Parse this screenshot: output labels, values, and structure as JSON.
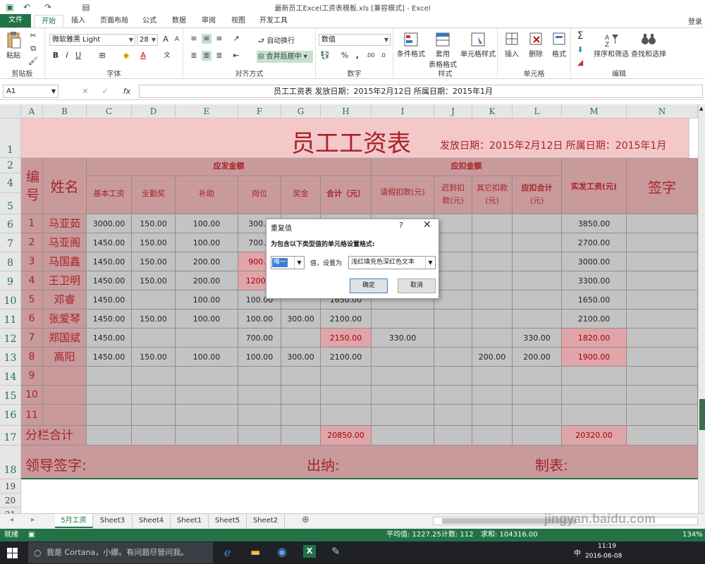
{
  "window": {
    "title": "最新员工Excel工资表模板.xls  [兼容模式] - Excel"
  },
  "tabs": [
    "文件",
    "开始",
    "插入",
    "页面布局",
    "公式",
    "数据",
    "审阅",
    "视图",
    "开发工具"
  ],
  "login": "登录",
  "ribbon": {
    "clipboard": {
      "paste": "粘贴",
      "label": "剪贴板"
    },
    "font": {
      "name": "微软雅黑 Light",
      "size": "28",
      "label": "字体"
    },
    "align": {
      "wrap": "自动换行",
      "merge": "合并后居中",
      "label": "对齐方式"
    },
    "number": {
      "format": "数值",
      "label": "数字"
    },
    "styles": {
      "cond": "条件格式",
      "table1": "套用",
      "table2": "表格格式",
      "cell": "单元格样式",
      "label": "样式"
    },
    "cells": {
      "insert": "插入",
      "delete": "删除",
      "format": "格式",
      "label": "单元格"
    },
    "edit": {
      "sort": "排序和筛选",
      "find": "查找和选择",
      "label": "编辑"
    }
  },
  "formula_bar": {
    "name_box": "A1",
    "fx": "fx",
    "content": "员工工资表   发放日期：2015年2月12日  所属日期：2015年1月"
  },
  "columns": [
    "A",
    "B",
    "C",
    "D",
    "E",
    "F",
    "G",
    "H",
    "I",
    "J",
    "K",
    "L",
    "M",
    "N"
  ],
  "rows": [
    "1",
    "2",
    "4",
    "5",
    "6",
    "7",
    "8",
    "9",
    "10",
    "11",
    "12",
    "13",
    "14",
    "15",
    "16",
    "17",
    "18",
    "19",
    "20",
    "21"
  ],
  "sheet": {
    "title": "员工工资表",
    "subtitle": "发放日期：2015年2月12日 所属日期：2015年1月",
    "h_no": "编号",
    "h_name": "姓名",
    "h_pay_group": "应发金额",
    "h_base": "基本工资",
    "h_attend": "全勤奖",
    "h_subsidy": "补助",
    "h_post": "岗位",
    "h_bonus": "奖金",
    "h_total": "合计（元）",
    "h_deduct_group": "应扣金额",
    "h_leave": "请假扣款(元)",
    "h_late1": "迟到扣",
    "h_late2": "款(元)",
    "h_other1": "其它扣款",
    "h_other2": "(元)",
    "h_deduct_total1": "应扣合计",
    "h_deduct_total2": "(元)",
    "h_net": "实发工资(元)",
    "h_sign": "签字",
    "subtotal_label": "分栏合计",
    "subtotal_total": "20850.00",
    "subtotal_net": "20320.00",
    "leader": "领导签字:",
    "cashier": "出纳:",
    "maker": "制表:"
  },
  "records": [
    {
      "no": "1",
      "name": "马亚茹",
      "base": "3000.00",
      "attend": "150.00",
      "subsidy": "100.00",
      "post": "300.0",
      "bonus": "",
      "total": "",
      "leave": "",
      "late": "",
      "other": "",
      "dtotal": "",
      "net": "3850.00"
    },
    {
      "no": "2",
      "name": "马亚阁",
      "base": "1450.00",
      "attend": "150.00",
      "subsidy": "100.00",
      "post": "700.0",
      "bonus": "",
      "total": "",
      "leave": "",
      "late": "",
      "other": "",
      "dtotal": "",
      "net": "2700.00"
    },
    {
      "no": "3",
      "name": "马国鑫",
      "base": "1450.00",
      "attend": "150.00",
      "subsidy": "200.00",
      "post": "900.0",
      "bonus": "",
      "total": "",
      "leave": "",
      "late": "",
      "other": "",
      "dtotal": "",
      "net": "3000.00"
    },
    {
      "no": "4",
      "name": "王卫明",
      "base": "1450.00",
      "attend": "150.00",
      "subsidy": "200.00",
      "post": "1200.0",
      "bonus": "",
      "total": "",
      "leave": "",
      "late": "",
      "other": "",
      "dtotal": "",
      "net": "3300.00"
    },
    {
      "no": "5",
      "name": "邓睿",
      "base": "1450.00",
      "attend": "",
      "subsidy": "100.00",
      "post": "100.00",
      "bonus": "",
      "total": "1650.00",
      "leave": "",
      "late": "",
      "other": "",
      "dtotal": "",
      "net": "1650.00"
    },
    {
      "no": "6",
      "name": "张爱琴",
      "base": "1450.00",
      "attend": "150.00",
      "subsidy": "100.00",
      "post": "100.00",
      "bonus": "300.00",
      "total": "2100.00",
      "leave": "",
      "late": "",
      "other": "",
      "dtotal": "",
      "net": "2100.00"
    },
    {
      "no": "7",
      "name": "郑国斌",
      "base": "1450.00",
      "attend": "",
      "subsidy": "",
      "post": "700.00",
      "bonus": "",
      "total": "2150.00",
      "leave": "330.00",
      "late": "",
      "other": "",
      "dtotal": "330.00",
      "net": "1820.00"
    },
    {
      "no": "8",
      "name": "高阳",
      "base": "1450.00",
      "attend": "150.00",
      "subsidy": "100.00",
      "post": "100.00",
      "bonus": "300.00",
      "total": "2100.00",
      "leave": "",
      "late": "",
      "other": "200.00",
      "dtotal": "200.00",
      "net": "1900.00"
    },
    {
      "no": "9",
      "name": "",
      "base": "",
      "attend": "",
      "subsidy": "",
      "post": "",
      "bonus": "",
      "total": "",
      "leave": "",
      "late": "",
      "other": "",
      "dtotal": "",
      "net": ""
    },
    {
      "no": "10",
      "name": "",
      "base": "",
      "attend": "",
      "subsidy": "",
      "post": "",
      "bonus": "",
      "total": "",
      "leave": "",
      "late": "",
      "other": "",
      "dtotal": "",
      "net": ""
    },
    {
      "no": "11",
      "name": "",
      "base": "",
      "attend": "",
      "subsidy": "",
      "post": "",
      "bonus": "",
      "total": "",
      "leave": "",
      "late": "",
      "other": "",
      "dtotal": "",
      "net": ""
    }
  ],
  "dialog": {
    "title": "重复值",
    "help": "?",
    "close": "✕",
    "message": "为包含以下类型值的单元格设置格式:",
    "type_value": "唯一",
    "mid_label": "值，设置为",
    "format_value": "浅红填充色深红色文本",
    "ok": "确定",
    "cancel": "取消"
  },
  "sheet_tabs": [
    "5月工资",
    "Sheet3",
    "Sheet4",
    "Sheet1",
    "Sheet5",
    "Sheet2"
  ],
  "status": {
    "mode": "就绪",
    "avg": "平均值: 1227.25",
    "count": "计数: 112",
    "sum": "求和: 104316.00",
    "zoom": "134%"
  },
  "taskbar": {
    "cortana": "我是 Cortana，小娜。有问题尽管问我。",
    "time": "11:19",
    "date": "2016-06-08",
    "ime": "中"
  },
  "watermark": "jingyan.baidu.com",
  "colors": {
    "excel_green": "#217346",
    "header_pink": "#c99a9c",
    "title_pink": "#f4c7c9",
    "dup_fill": "#e0a5a8",
    "dup_text": "#9c0006"
  }
}
